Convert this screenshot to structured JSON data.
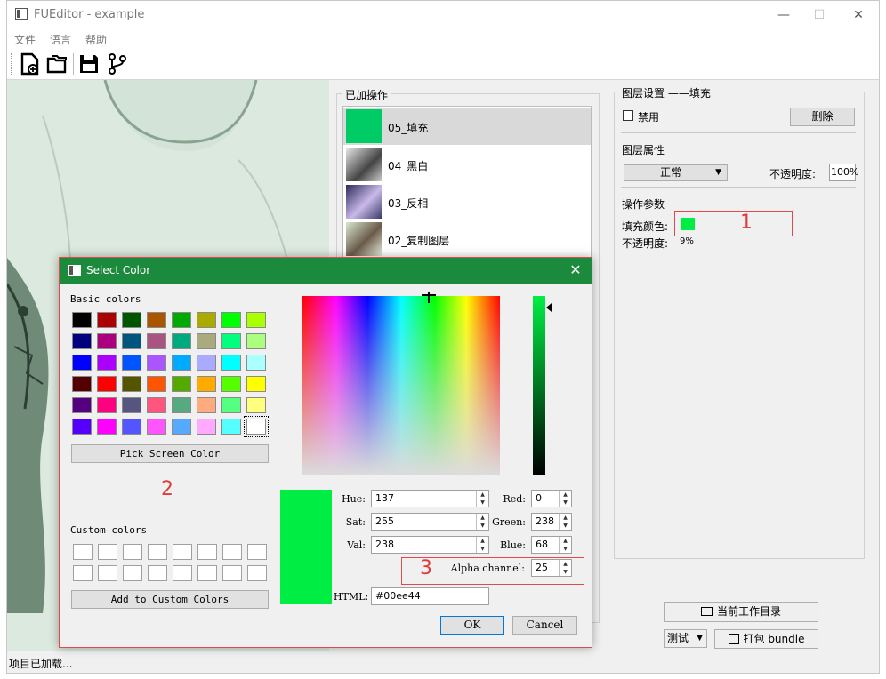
{
  "window": {
    "title": "FUEditor - example",
    "controls": {
      "minimize": "—",
      "maximize": "☐",
      "close": "✕"
    }
  },
  "menu": {
    "items": [
      "文件",
      "语言",
      "帮助"
    ]
  },
  "toolbar": {
    "icons": [
      "new-file-icon",
      "open-folder-icon",
      "save-icon",
      "branch-icon"
    ]
  },
  "ops_panel": {
    "title": "已加操作",
    "items": [
      {
        "label": "05_填充",
        "thumb_color": "#00cc66",
        "selected": true
      },
      {
        "label": "04_黑白",
        "selected": false
      },
      {
        "label": "03_反相",
        "selected": false
      },
      {
        "label": "02_复制图层",
        "selected": false
      }
    ]
  },
  "layer_settings": {
    "title": "图层设置 ——填充",
    "disable_label": "禁用",
    "delete_label": "删除",
    "props_label": "图层属性",
    "blend_mode": "正常",
    "opacity_label": "不透明度:",
    "opacity_value": "100%",
    "params_label": "操作参数",
    "fill_color_label": "填充颜色:",
    "fill_color": "#00ee44",
    "fill_opacity_label": "不透明度:",
    "fill_opacity_value": "9%"
  },
  "bottom": {
    "workdir_label": "当前工作目录",
    "mode_label": "测试",
    "pack_label": "打包 bundle"
  },
  "status": {
    "text": "项目已加载..."
  },
  "dialog": {
    "title": "Select Color",
    "basic_colors_label": "Basic colors",
    "basic_colors": [
      [
        "#000000",
        "#aa0000",
        "#005500",
        "#aa5500",
        "#00aa00",
        "#aaaa00",
        "#00ff00",
        "#aaff00"
      ],
      [
        "#00007f",
        "#aa007f",
        "#00557f",
        "#aa557f",
        "#00aa7f",
        "#aaaa7f",
        "#00ff7f",
        "#aaff7f"
      ],
      [
        "#0000ff",
        "#aa00ff",
        "#0055ff",
        "#aa55ff",
        "#00aaff",
        "#aaaaff",
        "#00ffff",
        "#aaffff"
      ],
      [
        "#550000",
        "#ff0000",
        "#555500",
        "#ff5500",
        "#55aa00",
        "#ffaa00",
        "#55ff00",
        "#ffff00"
      ],
      [
        "#55007f",
        "#ff007f",
        "#55557f",
        "#ff557f",
        "#55aa7f",
        "#ffaa7f",
        "#55ff7f",
        "#ffff7f"
      ],
      [
        "#5500ff",
        "#ff00ff",
        "#5555ff",
        "#ff55ff",
        "#55aaff",
        "#ffaaff",
        "#55ffff",
        "#ffffff"
      ]
    ],
    "pick_screen_label": "Pick Screen Color",
    "custom_colors_label": "Custom colors",
    "add_custom_label": "Add to Custom Colors",
    "fields": {
      "hue_label": "Hue:",
      "hue": "137",
      "sat_label": "Sat:",
      "sat": "255",
      "val_label": "Val:",
      "val": "238",
      "red_label": "Red:",
      "red": "0",
      "green_label": "Green:",
      "green": "238",
      "blue_label": "Blue:",
      "blue": "68",
      "alpha_label": "Alpha channel:",
      "alpha": "25",
      "html_label": "HTML:",
      "html": "#00ee44"
    },
    "preview_color": "#00ee44",
    "ok_label": "OK",
    "cancel_label": "Cancel"
  },
  "annotations": {
    "a1": "1",
    "a2": "2",
    "a3": "3"
  }
}
